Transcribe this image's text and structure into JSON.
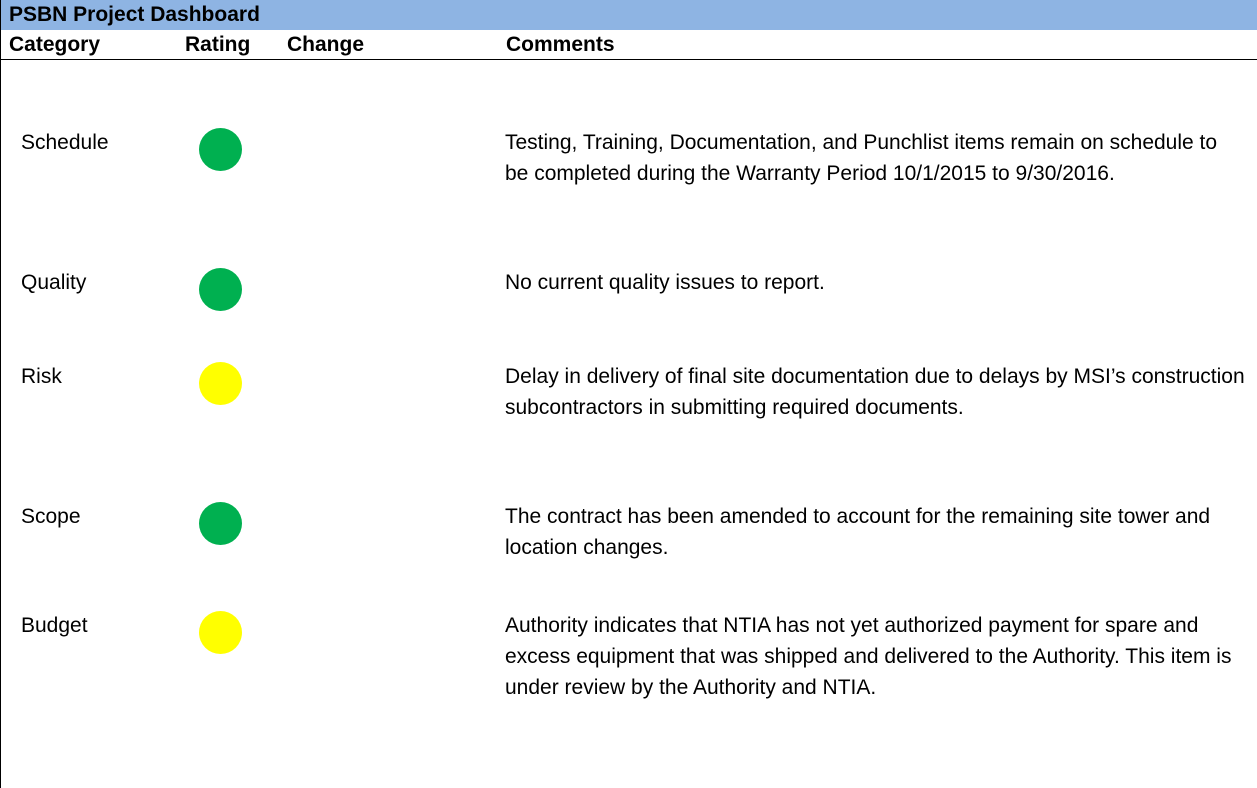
{
  "dashboard": {
    "title": "PSBN Project Dashboard",
    "header_bg": "#8eb4e3",
    "columns": {
      "category": "Category",
      "rating": "Rating",
      "change": "Change",
      "comments": "Comments"
    },
    "rows": [
      {
        "category": "Schedule",
        "rating_color": "#00b050",
        "change": "",
        "comment": "Testing, Training, Documentation, and Punchlist items remain on schedule to be completed during the Warranty Period 10/1/2015 to 9/30/2016."
      },
      {
        "category": "Quality",
        "rating_color": "#00b050",
        "change": "",
        "comment": "No current quality issues to report."
      },
      {
        "category": "Risk",
        "rating_color": "#ffff00",
        "change": "",
        "comment": "Delay in delivery of final site documentation due to delays by MSI’s construction subcontractors in submitting required documents."
      },
      {
        "category": "Scope",
        "rating_color": "#00b050",
        "change": "",
        "comment": "The contract has been amended to account for the remaining site tower and location changes."
      },
      {
        "category": "Budget",
        "rating_color": "#ffff00",
        "change": "",
        "comment": "Authority indicates that NTIA has not yet authorized payment for spare and excess equipment that was shipped and delivered to the Authority. This item is under review  by the Authority and NTIA."
      }
    ]
  }
}
